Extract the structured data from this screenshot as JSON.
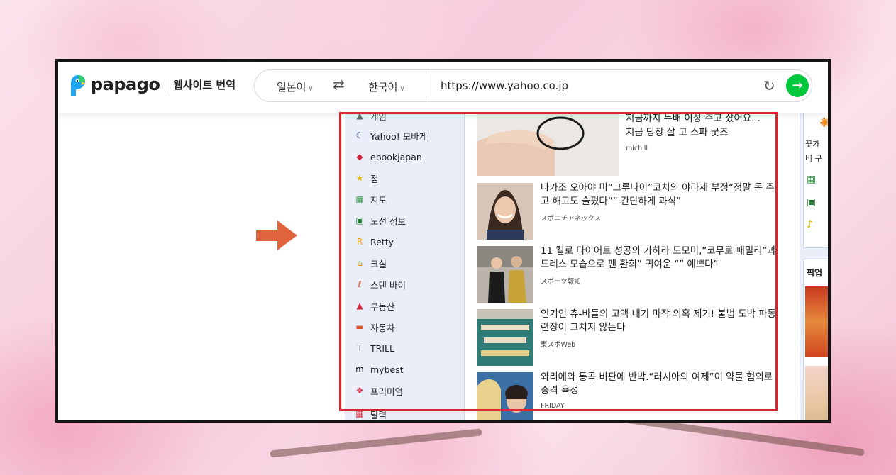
{
  "header": {
    "brand": "papago",
    "product": "웹사이트 번역",
    "source_lang": "일본어",
    "target_lang": "한국어",
    "swap_icon": "⇄",
    "url": "https://www.yahoo.co.jp",
    "refresh_icon": "↻",
    "go_icon": "→"
  },
  "sidebar": {
    "top_partial": "게임",
    "items": [
      {
        "label": "Yahoo! 모바게",
        "icon": "moon-icon",
        "glyph": "☾",
        "color": "#123a7a"
      },
      {
        "label": "ebookjapan",
        "icon": "book-icon",
        "glyph": "◆",
        "color": "#d6243b"
      },
      {
        "label": "점",
        "icon": "star-icon",
        "glyph": "★",
        "color": "#e7b800"
      },
      {
        "label": "지도",
        "icon": "map-icon",
        "glyph": "▦",
        "color": "#3a9a4e"
      },
      {
        "label": "노선 정보",
        "icon": "train-icon",
        "glyph": "▣",
        "color": "#2f7d3a"
      },
      {
        "label": "Retty",
        "icon": "retty-icon",
        "glyph": "R",
        "color": "#f0a000"
      },
      {
        "label": "크실",
        "icon": "house-icon",
        "glyph": "⌂",
        "color": "#e28a2b"
      },
      {
        "label": "스탠 바이",
        "icon": "standby-icon",
        "glyph": "ℓ",
        "color": "#e2572b"
      },
      {
        "label": "부동산",
        "icon": "realestate-icon",
        "glyph": "▲",
        "color": "#d6243b"
      },
      {
        "label": "자동차",
        "icon": "car-icon",
        "glyph": "▬",
        "color": "#e2572b"
      },
      {
        "label": "TRILL",
        "icon": "trill-icon",
        "glyph": "T",
        "color": "#999999"
      },
      {
        "label": "mybest",
        "icon": "mybest-icon",
        "glyph": "m",
        "color": "#111111"
      },
      {
        "label": "프리미엄",
        "icon": "premium-icon",
        "glyph": "❖",
        "color": "#d6243b"
      }
    ],
    "bottom_partial": "달력"
  },
  "news": {
    "top_partial_title": "지금까지 두배 이상 주고 샀어요...",
    "items": [
      {
        "title": "지금 당장 살 고 스파 굿즈",
        "source": "michill"
      },
      {
        "title": "나카조 오아야 미“그루나이”코치의 야라세 부정“정말 돈 주고 해고도 슬펐다“” 간단하게 과식”",
        "source": "スポニチアネックス"
      },
      {
        "title": "11 킬로 다이어트 성공의 가하라 도모미,“코무로 패밀리”과 드레스 모습으로 팬 환희” 귀여운 “” 예쁘다”",
        "source": "スポーツ報知"
      },
      {
        "title": "인기인 츄-바들의 고액 내기 마작 의혹 제기! 불법 도박 파동 련장이 그치지 않는다",
        "source": "東スポWeb"
      },
      {
        "title": "와리에와 통곡 비판에 반박.“러시아의 여제”이 약물 혐의로 중격 육성",
        "source": "FRIDAY"
      }
    ]
  },
  "rightcol": {
    "partial_1": "꽃가",
    "partial_2": "비 구",
    "partial_3": "픽업"
  },
  "colors": {
    "highlight": "#d8252f",
    "go_button": "#00c73c",
    "arrow": "#e0653f",
    "sidebar_bg": "#e9eef9"
  }
}
